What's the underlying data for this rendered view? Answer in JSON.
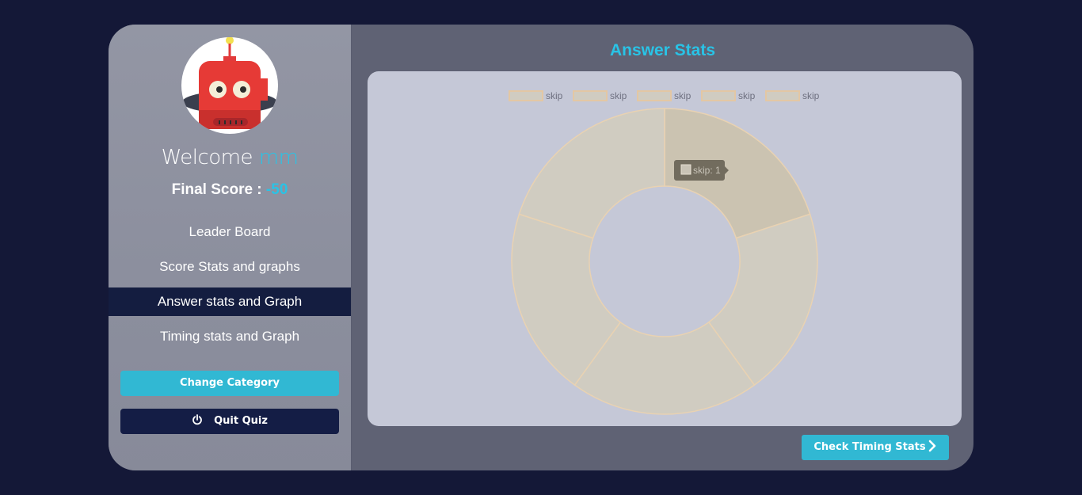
{
  "sidebar": {
    "welcome_text": "Welcome",
    "user_name": "mm",
    "score_label": "Final Score :",
    "score_value": "-50",
    "nav": [
      {
        "label": "Leader Board",
        "active": false
      },
      {
        "label": "Score Stats and graphs",
        "active": false
      },
      {
        "label": "Answer stats and Graph",
        "active": true
      },
      {
        "label": "Timing stats and Graph",
        "active": false
      }
    ],
    "change_category_label": "Change Category",
    "quit_label": "Quit Quiz"
  },
  "main": {
    "title": "Answer Stats",
    "next_button_label": "Check Timing Stats"
  },
  "colors": {
    "accent": "#29c3e6",
    "background": "#141837",
    "active_nav": "#141d40",
    "slice_fill": "#d0ccc1"
  },
  "chart_data": {
    "type": "pie",
    "variant": "doughnut",
    "title": "",
    "categories": [
      "skip",
      "skip",
      "skip",
      "skip",
      "skip"
    ],
    "values": [
      1,
      1,
      1,
      1,
      1
    ],
    "legend": {
      "position": "top",
      "entries": [
        "skip",
        "skip",
        "skip",
        "skip",
        "skip"
      ]
    },
    "tooltip": {
      "label": "skip",
      "value": 1,
      "text": "skip: 1"
    }
  }
}
